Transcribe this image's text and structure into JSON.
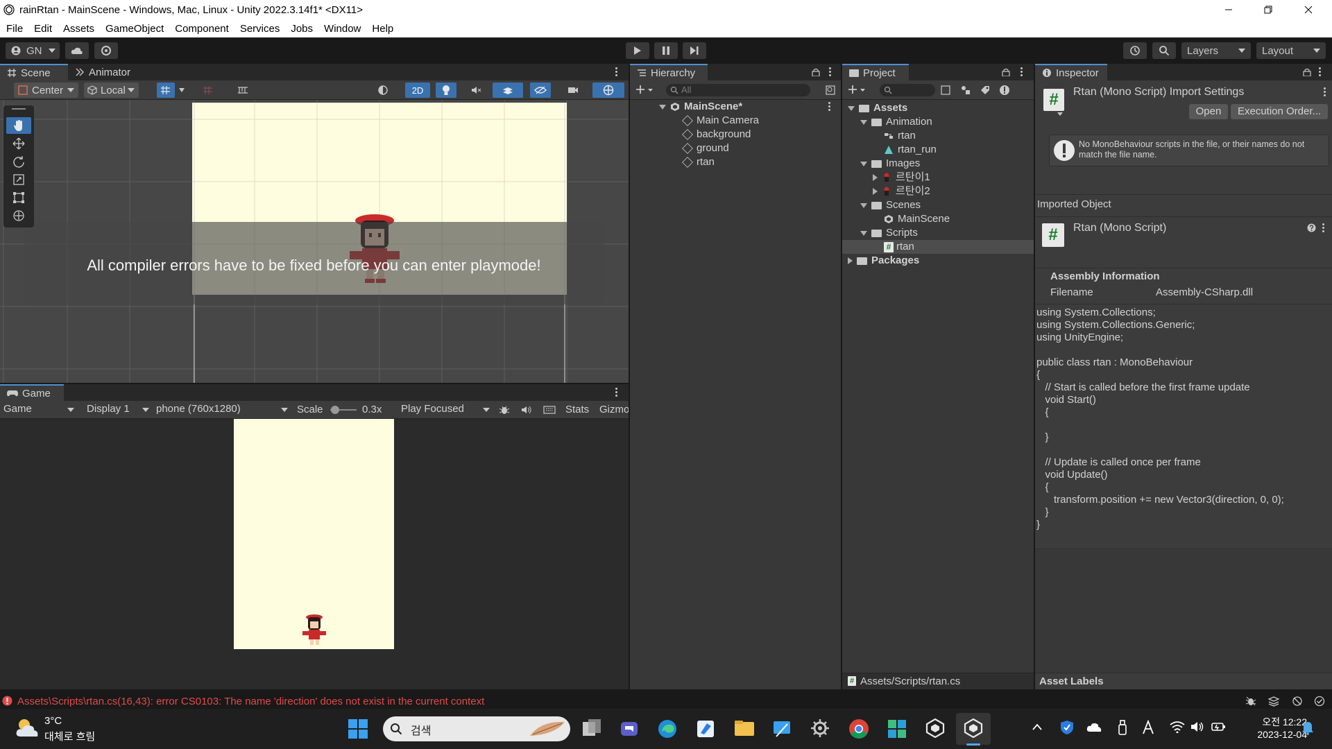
{
  "window": {
    "title": "rainRtan - MainScene - Windows, Mac, Linux - Unity 2022.3.14f1* <DX11>"
  },
  "menu": [
    "File",
    "Edit",
    "Assets",
    "GameObject",
    "Component",
    "Services",
    "Jobs",
    "Window",
    "Help"
  ],
  "toolbar": {
    "account": "GN",
    "layers": "Layers",
    "layout": "Layout"
  },
  "scene": {
    "tabs": [
      "Scene",
      "Animator"
    ],
    "pivot": "Center",
    "space": "Local",
    "mode2d": "2D",
    "overlay_message": "All compiler errors have to be fixed before you can enter playmode!"
  },
  "game": {
    "tab": "Game",
    "view": "Game",
    "display": "Display 1",
    "resolution": "phone (760x1280)",
    "scale_label": "Scale",
    "scale_value": "0.3x",
    "play_mode": "Play Focused",
    "stats": "Stats",
    "gizmos": "Gizmo"
  },
  "hierarchy": {
    "tab": "Hierarchy",
    "search_placeholder": "All",
    "scene": "MainScene*",
    "items": [
      "Main Camera",
      "background",
      "ground",
      "rtan"
    ]
  },
  "project": {
    "tab": "Project",
    "root": "Assets",
    "animation": "Animation",
    "animation_items": [
      "rtan",
      "rtan_run"
    ],
    "images": "Images",
    "image_items": [
      "르탄이1",
      "르탄이2"
    ],
    "scenes": "Scenes",
    "scene_items": [
      "MainScene"
    ],
    "scripts": "Scripts",
    "script_items": [
      "rtan"
    ],
    "packages": "Packages",
    "path": "Assets/Scripts/rtan.cs"
  },
  "inspector": {
    "tab": "Inspector",
    "title": "Rtan (Mono Script) Import Settings",
    "open": "Open",
    "execution_order": "Execution Order...",
    "warning": "No MonoBehaviour scripts in the file, or their names do not match the file name.",
    "imported_object": "Imported Object",
    "object_name": "Rtan (Mono Script)",
    "assembly_info": "Assembly Information",
    "filename_label": "Filename",
    "filename_value": "Assembly-CSharp.dll",
    "code": "using System.Collections;\nusing System.Collections.Generic;\nusing UnityEngine;\n\npublic class rtan : MonoBehaviour\n{\n   // Start is called before the first frame update\n   void Start()\n   {\n\n   }\n\n   // Update is called once per frame\n   void Update()\n   {\n      transform.position += new Vector3(direction, 0, 0);\n   }\n}",
    "asset_labels": "Asset Labels"
  },
  "console": {
    "error": "Assets\\Scripts\\rtan.cs(16,43): error CS0103: The name 'direction' does not exist in the current context"
  },
  "taskbar": {
    "weather_temp": "3°C",
    "weather_desc": "대체로 흐림",
    "search": "검색",
    "time": "오전 12:22",
    "date": "2023-12-04"
  },
  "colors": {
    "accent": "#4f8fd6",
    "error": "#e04a4a",
    "scene_bg": "#fffde0"
  }
}
